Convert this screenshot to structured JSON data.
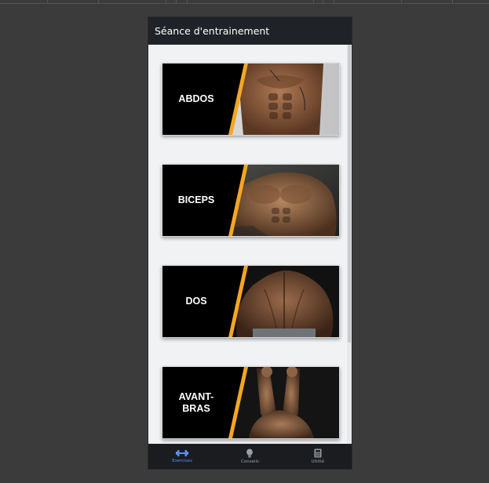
{
  "app": {
    "title": "Séance d'entrainement"
  },
  "exercises": [
    {
      "label": "ABDOS",
      "image": "abs-photo"
    },
    {
      "label": "BICEPS",
      "image": "chest-arms-photo"
    },
    {
      "label": "DOS",
      "image": "back-photo"
    },
    {
      "label": "AVANT-\nBRAS",
      "image": "forearms-photo"
    }
  ],
  "nav": [
    {
      "label": "Exercises",
      "icon": "dumbbell-icon",
      "active": true
    },
    {
      "label": "Conseils",
      "icon": "lightbulb-icon",
      "active": false
    },
    {
      "label": "Utilité",
      "icon": "calculator-icon",
      "active": false
    }
  ],
  "colors": {
    "accent": "#f5a623",
    "appbar": "#1f2226",
    "active_nav": "#5b8def"
  }
}
